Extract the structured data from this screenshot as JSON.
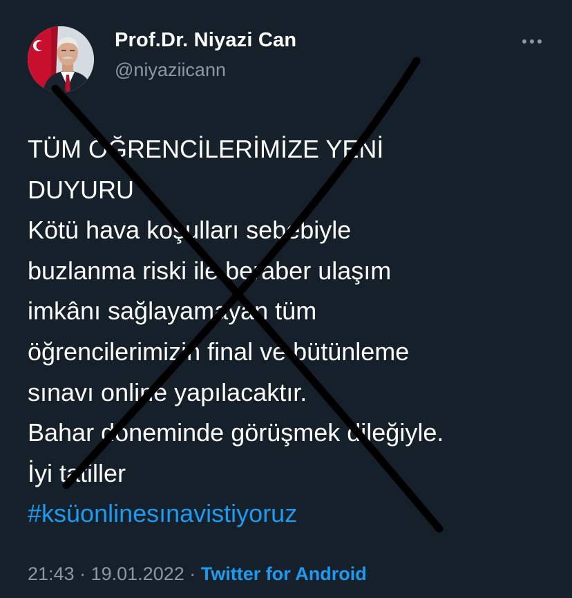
{
  "author": {
    "display_name": "Prof.Dr. Niyazi Can",
    "handle": "@niyaziicann"
  },
  "more_icon": "more-horizontal-icon",
  "tweet": {
    "lines": [
      "TÜM ÖĞRENCİLERİMİZE YENİ",
      "DUYURU",
      "Kötü hava koşulları sebebiyle",
      "buzlanma riski ile beraber ulaşım",
      "imkânı sağlayamayan tüm",
      "öğrencilerimizin final ve bütünleme",
      "sınavı online yapılacaktır.",
      "Bahar döneminde görüşmek dileğiyle.",
      "İyi tatiller"
    ],
    "hashtag": "#ksüonlinesınavistiyoruz",
    "time": "21:43",
    "separator1": "·",
    "date": "19.01.2022",
    "separator2": "·",
    "source": "Twitter for Android"
  },
  "colors": {
    "background": "#15202b",
    "text": "#ffffff",
    "secondary": "#8b98a5",
    "link": "#1d9bf0",
    "cross_mark": "#000000"
  }
}
